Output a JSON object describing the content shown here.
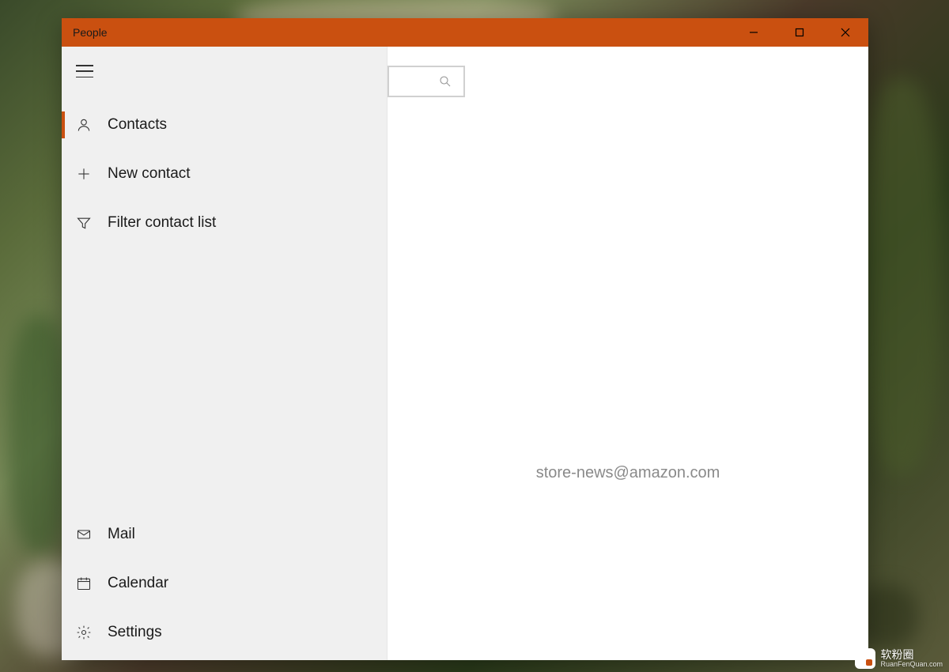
{
  "window": {
    "title": "People"
  },
  "sidebar": {
    "items_top": [
      {
        "label": "Contacts",
        "icon": "person-icon",
        "active": true
      },
      {
        "label": "New contact",
        "icon": "plus-icon",
        "active": false
      },
      {
        "label": "Filter contact list",
        "icon": "filter-icon",
        "active": false
      }
    ],
    "items_bottom": [
      {
        "label": "Mail",
        "icon": "mail-icon"
      },
      {
        "label": "Calendar",
        "icon": "calendar-icon"
      },
      {
        "label": "Settings",
        "icon": "gear-icon"
      }
    ]
  },
  "main": {
    "email_text": "store-news@amazon.com"
  },
  "watermark": {
    "text": "软粉圈",
    "sub": "RuanFenQuan.com"
  }
}
